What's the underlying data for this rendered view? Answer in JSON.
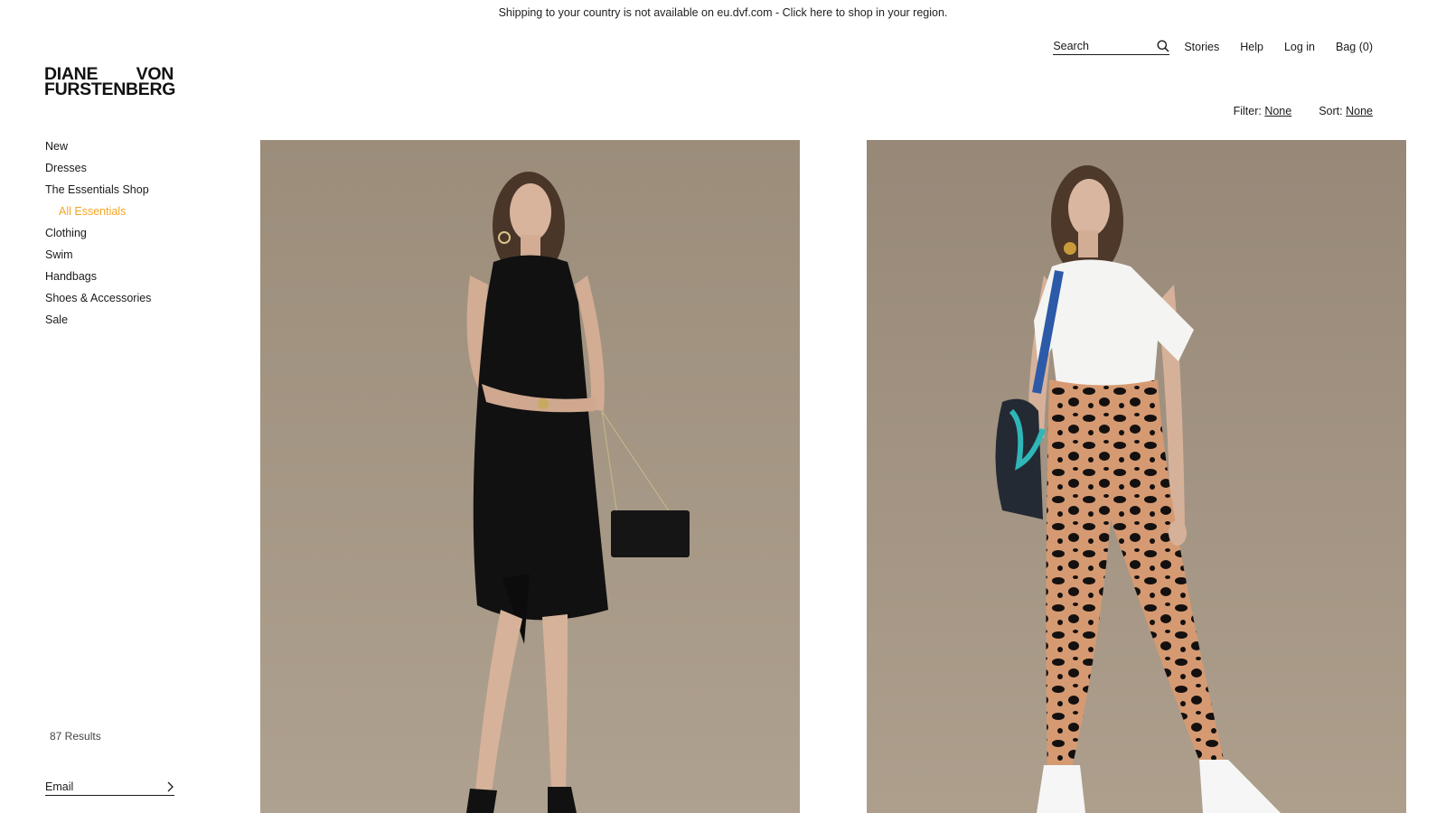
{
  "banner": {
    "text": "Shipping to your country is not available on eu.dvf.com - Click here to shop in your region."
  },
  "header": {
    "search_placeholder": "Search",
    "links": {
      "stories": "Stories",
      "help": "Help",
      "login": "Log in",
      "bag": "Bag (0)"
    }
  },
  "logo": {
    "word1": "DIANE",
    "word2": "VON",
    "word3": "FURSTENBERG"
  },
  "filters": {
    "filter_label": "Filter:",
    "filter_value": "None",
    "sort_label": "Sort:",
    "sort_value": "None"
  },
  "sidebar": {
    "items": [
      {
        "label": "New"
      },
      {
        "label": "Dresses"
      },
      {
        "label": "The Essentials Shop"
      },
      {
        "label": "All Essentials",
        "active": true
      },
      {
        "label": "Clothing"
      },
      {
        "label": "Swim"
      },
      {
        "label": "Handbags"
      },
      {
        "label": "Shoes & Accessories"
      },
      {
        "label": "Sale"
      }
    ],
    "results": "87 Results",
    "email_placeholder": "Email"
  },
  "colors": {
    "accent": "#f5a623",
    "photo_background": "#a99a87",
    "text": "#1a1a1a"
  }
}
